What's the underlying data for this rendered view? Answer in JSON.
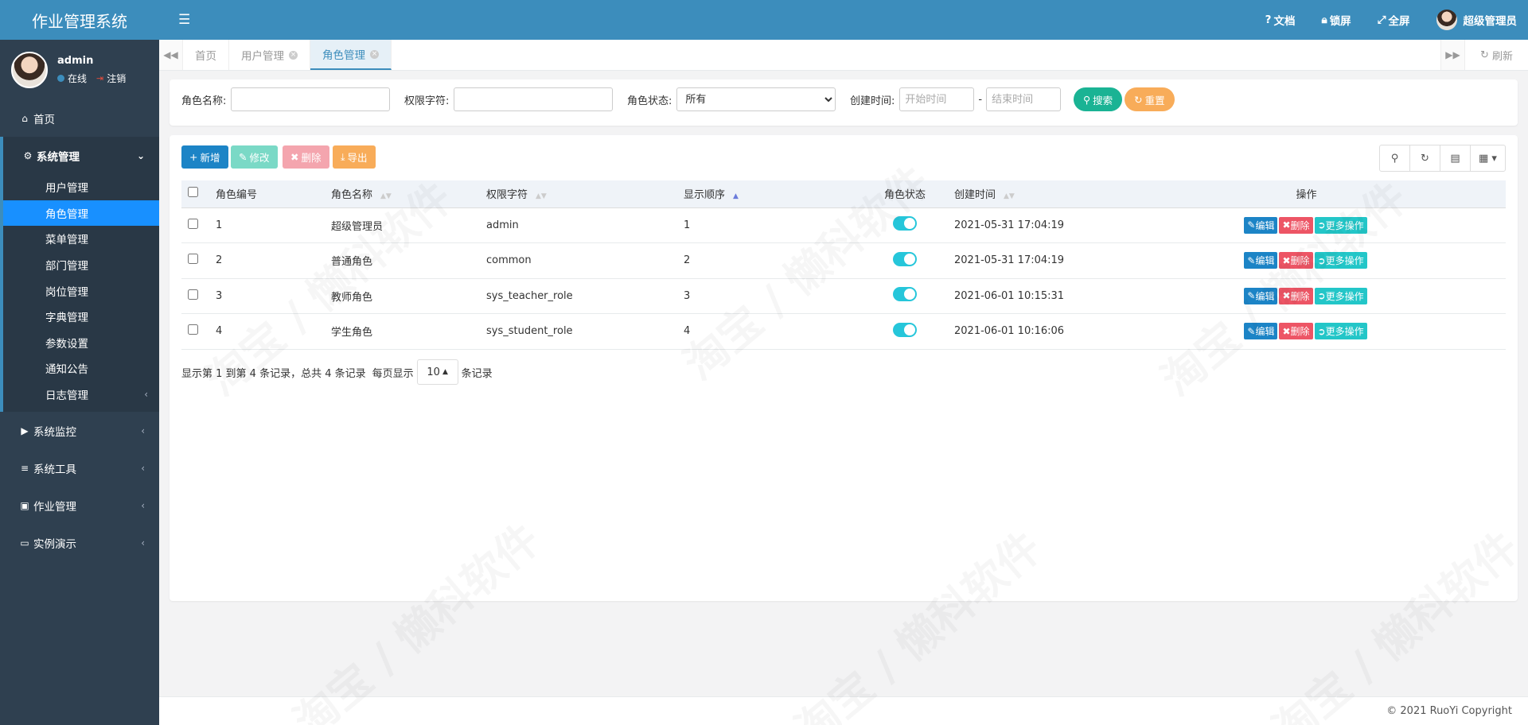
{
  "app": {
    "title": "作业管理系统"
  },
  "user": {
    "name": "admin",
    "status": "在线",
    "logout": "注销"
  },
  "nav": {
    "home": "首页",
    "system": "系统管理",
    "system_items": [
      "用户管理",
      "角色管理",
      "菜单管理",
      "部门管理",
      "岗位管理",
      "字典管理",
      "参数设置",
      "通知公告",
      "日志管理"
    ],
    "monitor": "系统监控",
    "tools": "系统工具",
    "homework": "作业管理",
    "demo": "实例演示"
  },
  "header": {
    "docs": "文档",
    "lock": "锁屏",
    "fullscreen": "全屏",
    "username": "超级管理员"
  },
  "tabs": {
    "home": "首页",
    "user": "用户管理",
    "role": "角色管理",
    "refresh": "刷新"
  },
  "search": {
    "role_name_label": "角色名称:",
    "perm_label": "权限字符:",
    "status_label": "角色状态:",
    "status_value": "所有",
    "time_label": "创建时间:",
    "start_placeholder": "开始时间",
    "end_placeholder": "结束时间",
    "dash": "-",
    "search_btn": "搜索",
    "reset_btn": "重置"
  },
  "toolbar": {
    "add": "新增",
    "edit": "修改",
    "delete": "删除",
    "export": "导出"
  },
  "table": {
    "headers": {
      "id": "角色编号",
      "name": "角色名称",
      "perm": "权限字符",
      "order": "显示顺序",
      "status": "角色状态",
      "created": "创建时间",
      "ops": "操作"
    },
    "rows": [
      {
        "id": "1",
        "name": "超级管理员",
        "perm": "admin",
        "order": "1",
        "created": "2021-05-31 17:04:19"
      },
      {
        "id": "2",
        "name": "普通角色",
        "perm": "common",
        "order": "2",
        "created": "2021-05-31 17:04:19"
      },
      {
        "id": "3",
        "name": "教师角色",
        "perm": "sys_teacher_role",
        "order": "3",
        "created": "2021-06-01 10:15:31"
      },
      {
        "id": "4",
        "name": "学生角色",
        "perm": "sys_student_role",
        "order": "4",
        "created": "2021-06-01 10:16:06"
      }
    ],
    "ops": {
      "edit": "编辑",
      "delete": "删除",
      "more": "更多操作"
    }
  },
  "pagination": {
    "info": "显示第 1 到第 4 条记录，总共 4 条记录",
    "per_page_pre": "每页显示",
    "page_size": "10",
    "per_page_post": "条记录"
  },
  "footer": {
    "copyright": "© 2021 RuoYi Copyright"
  },
  "watermark": "淘宝 / 懒科软件",
  "colors": {
    "primary": "#3c8dbc",
    "sidebar": "#2f4050",
    "active_menu": "#1890ff",
    "success": "#1ab394",
    "warning": "#f8ac59",
    "danger": "#ed5565",
    "info": "#23c6c8"
  }
}
